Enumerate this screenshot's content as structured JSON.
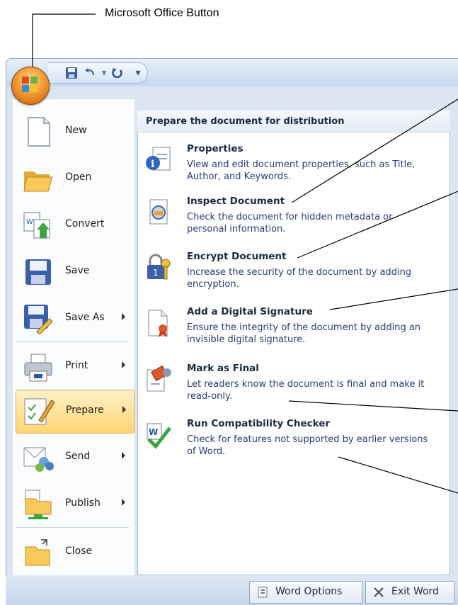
{
  "callout": {
    "label": "Microsoft Office Button"
  },
  "quick_access": {
    "save": "save-icon",
    "undo": "undo-icon",
    "redo": "redo-icon",
    "customize": "▾"
  },
  "left_menu": [
    {
      "label": "New",
      "icon": "new-document-icon",
      "submenu": false
    },
    {
      "label": "Open",
      "icon": "open-folder-icon",
      "submenu": false
    },
    {
      "label": "Convert",
      "icon": "convert-icon",
      "submenu": false
    },
    {
      "label": "Save",
      "icon": "save-icon",
      "submenu": false
    },
    {
      "label": "Save As",
      "icon": "save-as-icon",
      "submenu": true
    },
    {
      "label": "Print",
      "icon": "printer-icon",
      "submenu": true
    },
    {
      "label": "Prepare",
      "icon": "prepare-icon",
      "submenu": true,
      "active": true
    },
    {
      "label": "Send",
      "icon": "send-icon",
      "submenu": true
    },
    {
      "label": "Publish",
      "icon": "publish-icon",
      "submenu": true
    },
    {
      "label": "Close",
      "icon": "close-folder-icon",
      "submenu": false
    }
  ],
  "prepare_panel": {
    "heading": "Prepare the document for distribution",
    "items": [
      {
        "title": "Properties",
        "desc": "View and edit document properties, such as Title, Author, and Keywords.",
        "icon": "properties-icon"
      },
      {
        "title": "Inspect Document",
        "desc": "Check the document for hidden metadata or personal information.",
        "icon": "inspect-icon"
      },
      {
        "title": "Encrypt Document",
        "desc": "Increase the security of the document by adding encryption.",
        "icon": "lock-key-icon"
      },
      {
        "title": "Add a Digital Signature",
        "desc": "Ensure the integrity of the document by adding an invisible digital signature.",
        "icon": "signature-icon"
      },
      {
        "title": "Mark as Final",
        "desc": "Let readers know the document is final and make it read-only.",
        "icon": "mark-final-icon"
      },
      {
        "title": "Run Compatibility Checker",
        "desc": "Check for features not supported by earlier versions of Word.",
        "icon": "compatibility-icon"
      }
    ]
  },
  "bottom_buttons": {
    "options": "Word Options",
    "exit": "Exit Word"
  },
  "colors": {
    "accent": "#f39b32",
    "frame": "#dce6f3",
    "text_blue": "#2b3c74",
    "active_item": "#ffd571"
  }
}
